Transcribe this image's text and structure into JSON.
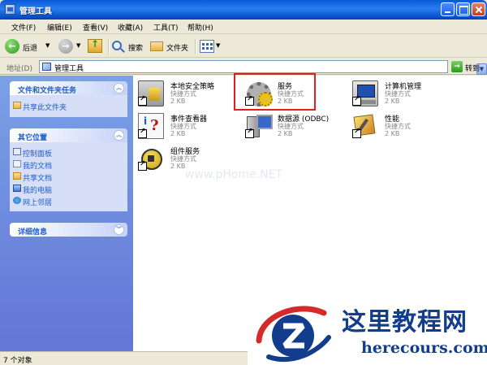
{
  "window": {
    "title": "管理工具"
  },
  "menu": {
    "file": "文件(F)",
    "edit": "编辑(E)",
    "view": "查看(V)",
    "favorites": "收藏(A)",
    "tools": "工具(T)",
    "help": "帮助(H)"
  },
  "toolbar": {
    "back_label": "后退",
    "search_label": "搜索",
    "folders_label": "文件夹"
  },
  "address": {
    "label": "地址(D)",
    "value": "管理工具",
    "go_label": "转到"
  },
  "taskpane": {
    "file_tasks": {
      "title": "文件和文件夹任务",
      "items": [
        {
          "label": "共享此文件夹",
          "icon": "share-folder-icon"
        }
      ]
    },
    "other_places": {
      "title": "其它位置",
      "items": [
        {
          "label": "控制面板",
          "icon": "control-panel-icon"
        },
        {
          "label": "我的文档",
          "icon": "my-documents-icon"
        },
        {
          "label": "共享文档",
          "icon": "shared-documents-icon"
        },
        {
          "label": "我的电脑",
          "icon": "my-computer-icon"
        },
        {
          "label": "网上邻居",
          "icon": "network-places-icon"
        }
      ]
    },
    "details": {
      "title": "详细信息"
    }
  },
  "content": {
    "items": [
      {
        "name": "本地安全策略",
        "type": "快捷方式",
        "size": "2 KB",
        "icon": "local-security-policy-icon"
      },
      {
        "name": "服务",
        "type": "快捷方式",
        "size": "2 KB",
        "icon": "services-icon"
      },
      {
        "name": "计算机管理",
        "type": "快捷方式",
        "size": "2 KB",
        "icon": "computer-management-icon"
      },
      {
        "name": "事件查看器",
        "type": "快捷方式",
        "size": "2 KB",
        "icon": "event-viewer-icon"
      },
      {
        "name": "数据源 (ODBC)",
        "type": "快捷方式",
        "size": "2 KB",
        "icon": "odbc-datasource-icon"
      },
      {
        "name": "性能",
        "type": "快捷方式",
        "size": "2 KB",
        "icon": "performance-icon"
      },
      {
        "name": "组件服务",
        "type": "快捷方式",
        "size": "2 KB",
        "icon": "component-services-icon"
      }
    ],
    "watermark": "www.pHome.NET"
  },
  "status": {
    "text": "7 个对象"
  },
  "logo": {
    "title": "这里教程网",
    "url": "herecours.com"
  },
  "colors": {
    "titlebar": "#0a5ad6",
    "taskpane": "#6f8ee0",
    "link": "#215dc6",
    "highlight": "#e02020",
    "logo": "#123c8c"
  }
}
